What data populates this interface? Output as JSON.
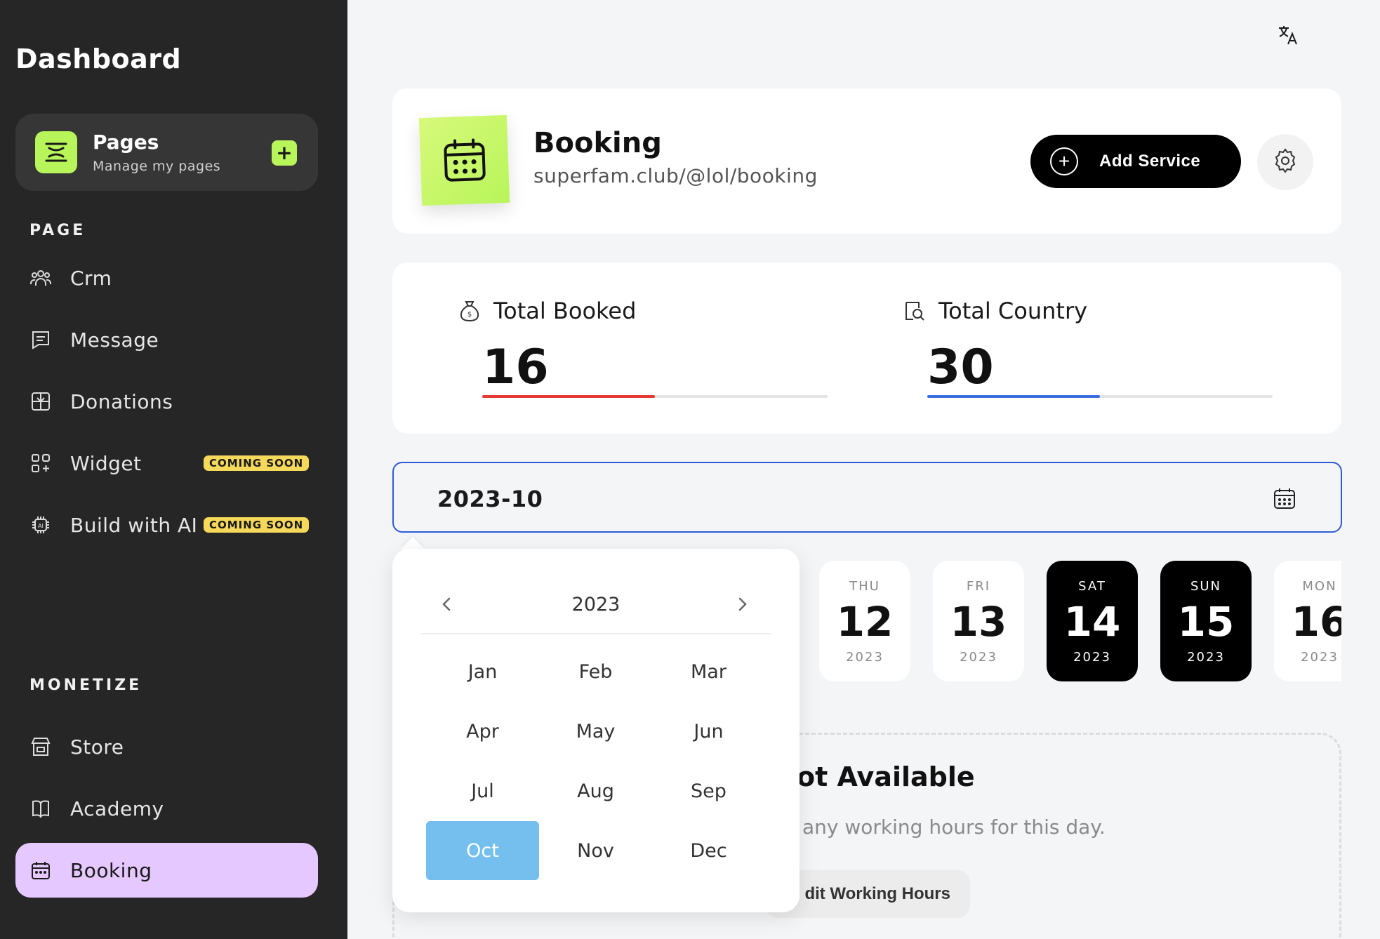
{
  "sidebar": {
    "brand": "Dashboard",
    "pages_card": {
      "title": "Pages",
      "subtitle": "Manage my pages",
      "add_label": "+"
    },
    "sections": [
      {
        "label": "PAGE",
        "items": [
          {
            "label": "Crm",
            "icon": "users-icon"
          },
          {
            "label": "Message",
            "icon": "message-icon"
          },
          {
            "label": "Donations",
            "icon": "gift-icon"
          },
          {
            "label": "Widget",
            "icon": "widget-icon",
            "badge": "COMING SOON"
          },
          {
            "label": "Build with AI",
            "icon": "ai-chip-icon",
            "badge": "COMING SOON"
          }
        ]
      },
      {
        "label": "MONETIZE",
        "items": [
          {
            "label": "Store",
            "icon": "store-icon"
          },
          {
            "label": "Academy",
            "icon": "book-icon"
          },
          {
            "label": "Booking",
            "icon": "calendar-icon",
            "active": true
          }
        ]
      }
    ]
  },
  "header": {
    "title": "Booking",
    "url": "superfam.club/@lol/booking",
    "add_service_label": "Add Service"
  },
  "stats": [
    {
      "label": "Total Booked",
      "value": "16",
      "icon": "money-bag-icon",
      "progress": 0.5,
      "color": "#e53935"
    },
    {
      "label": "Total Country",
      "value": "30",
      "icon": "search-document-icon",
      "progress": 0.5,
      "color": "#3b6fe0"
    }
  ],
  "month_picker": {
    "value": "2023-10",
    "year": "2023",
    "months": [
      "Jan",
      "Feb",
      "Mar",
      "Apr",
      "May",
      "Jun",
      "Jul",
      "Aug",
      "Sep",
      "Oct",
      "Nov",
      "Dec"
    ],
    "selected": "Oct",
    "selected_color": "#74bfed"
  },
  "days": [
    {
      "dow": "THU",
      "num": "12",
      "year": "2023",
      "dark": false
    },
    {
      "dow": "FRI",
      "num": "13",
      "year": "2023",
      "dark": false
    },
    {
      "dow": "SAT",
      "num": "14",
      "year": "2023",
      "dark": true
    },
    {
      "dow": "SUN",
      "num": "15",
      "year": "2023",
      "dark": true
    },
    {
      "dow": "MON",
      "num": "16",
      "year": "2023",
      "dark": false
    }
  ],
  "empty_state": {
    "title": "ot Available",
    "subtitle": "any working hours for this day.",
    "button": "dit Working Hours"
  },
  "colors": {
    "sidebar_bg": "#262626",
    "accent_green": "#b7f55a",
    "active_nav": "#e4c8ff",
    "badge": "#f6d85a",
    "input_border": "#2f5bd8"
  }
}
